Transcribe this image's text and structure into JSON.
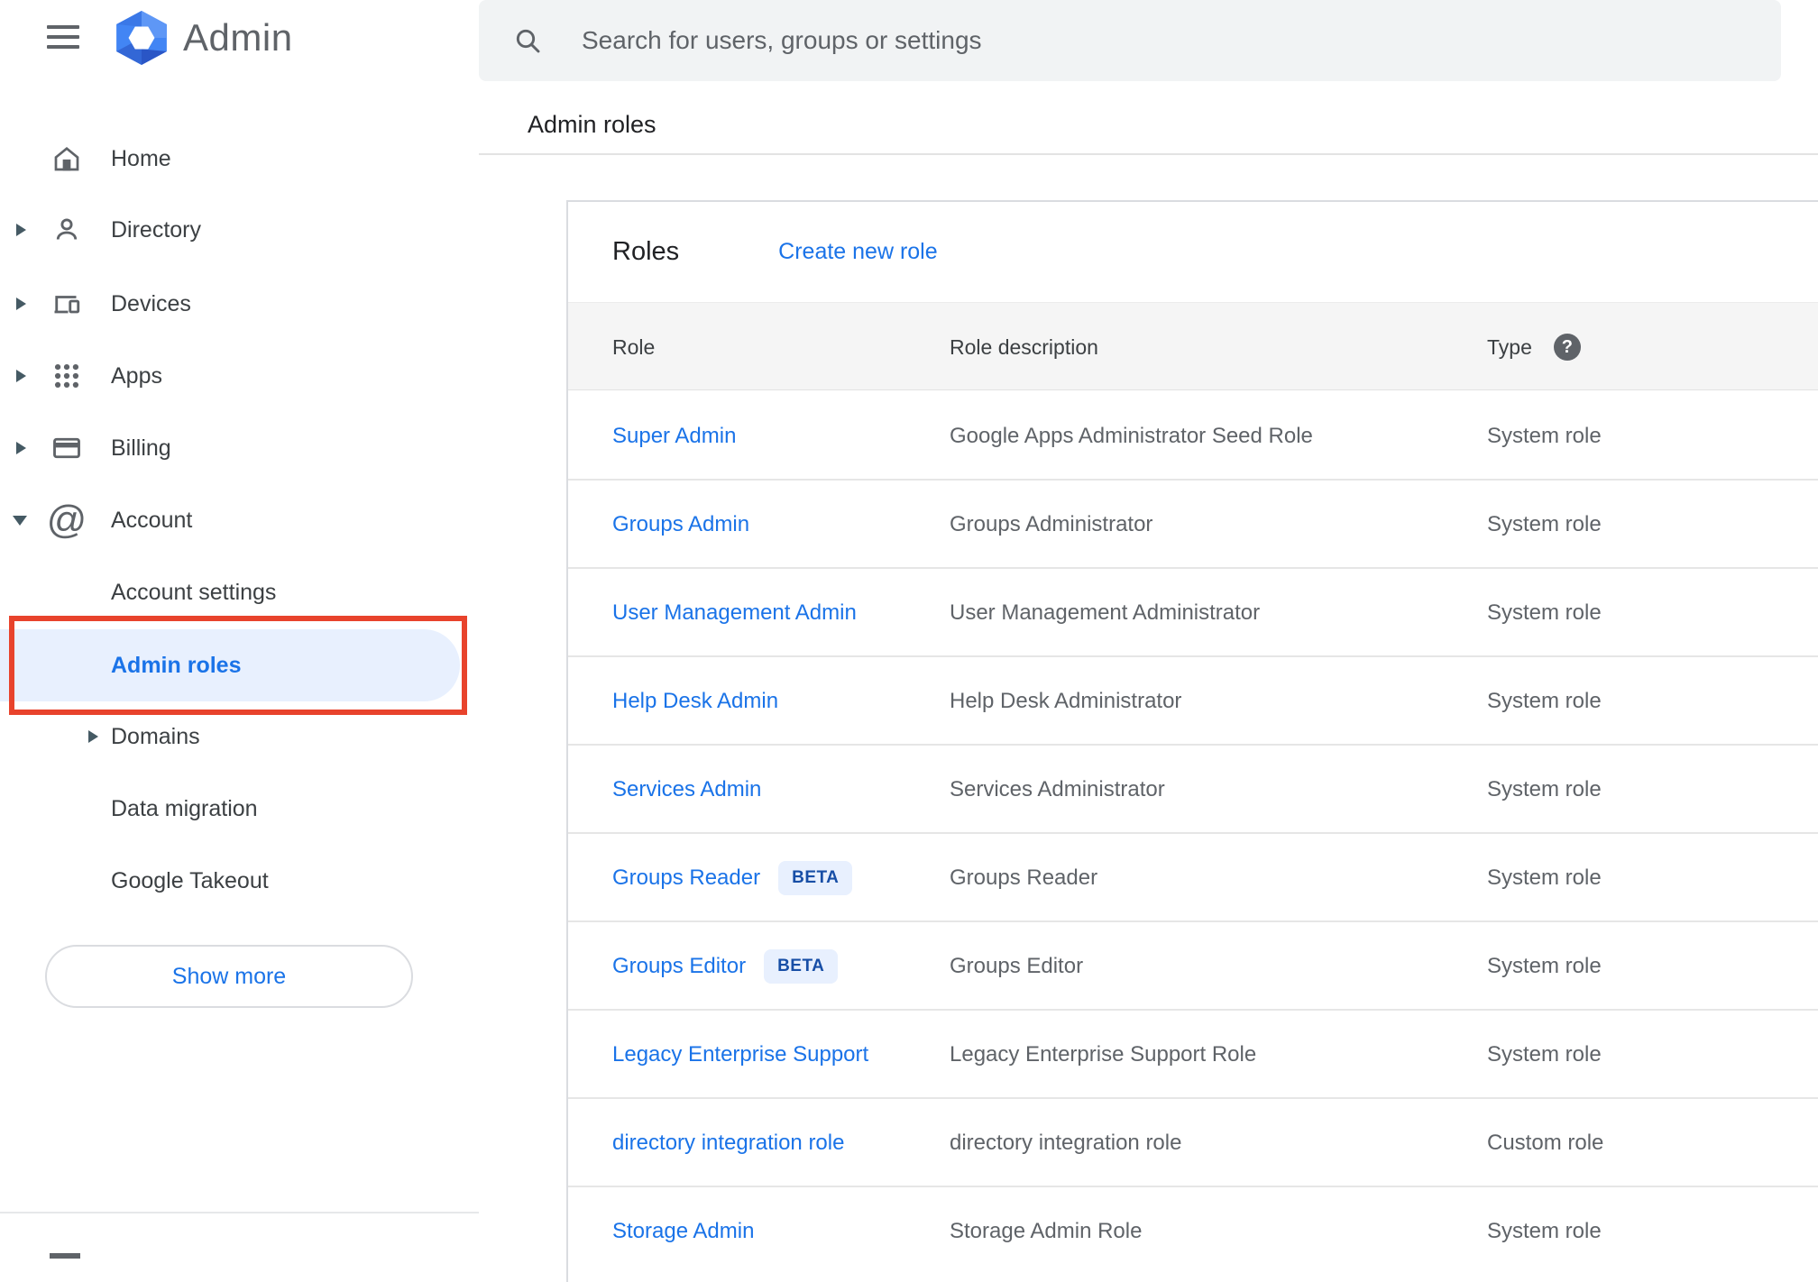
{
  "app": {
    "title": "Admin"
  },
  "search": {
    "placeholder": "Search for users, groups or settings"
  },
  "breadcrumb": "Admin roles",
  "sidebar": {
    "items": [
      {
        "label": "Home",
        "arrow": "none"
      },
      {
        "label": "Directory",
        "arrow": "right"
      },
      {
        "label": "Devices",
        "arrow": "right"
      },
      {
        "label": "Apps",
        "arrow": "right"
      },
      {
        "label": "Billing",
        "arrow": "right"
      },
      {
        "label": "Account",
        "arrow": "down"
      }
    ],
    "sub_items": [
      {
        "label": "Account settings",
        "selected": false
      },
      {
        "label": "Admin roles",
        "selected": true
      },
      {
        "label": "Domains",
        "arrow": "right",
        "selected": false
      },
      {
        "label": "Data migration",
        "selected": false
      },
      {
        "label": "Google Takeout",
        "selected": false
      }
    ],
    "show_more_label": "Show more"
  },
  "main": {
    "card_title": "Roles",
    "create_link": "Create new role",
    "table": {
      "columns": [
        "Role",
        "Role description",
        "Type"
      ],
      "help_glyph": "?",
      "rows": [
        {
          "role": "Super Admin",
          "description": "Google Apps Administrator Seed Role",
          "type": "System role"
        },
        {
          "role": "Groups Admin",
          "description": "Groups Administrator",
          "type": "System role"
        },
        {
          "role": "User Management Admin",
          "description": "User Management Administrator",
          "type": "System role"
        },
        {
          "role": "Help Desk Admin",
          "description": "Help Desk Administrator",
          "type": "System role"
        },
        {
          "role": "Services Admin",
          "description": "Services Administrator",
          "type": "System role"
        },
        {
          "role": "Groups Reader",
          "badge": "BETA",
          "description": "Groups Reader",
          "type": "System role"
        },
        {
          "role": "Groups Editor",
          "badge": "BETA",
          "description": "Groups Editor",
          "type": "System role"
        },
        {
          "role": "Legacy Enterprise Support",
          "description": "Legacy Enterprise Support Role",
          "type": "System role"
        },
        {
          "role": "directory integration role",
          "description": "directory integration role",
          "type": "Custom role"
        },
        {
          "role": "Storage Admin",
          "description": "Storage Admin Role",
          "type": "System role"
        }
      ]
    }
  },
  "colors": {
    "accent_blue": "#1a73e8",
    "selected_bg": "#e8f0fe",
    "badge_bg": "#e8f0fe",
    "badge_text": "#174ea6",
    "annotation_red": "#e8432c",
    "header_band": "#f5f5f5",
    "gray_text": "#5f6368"
  }
}
